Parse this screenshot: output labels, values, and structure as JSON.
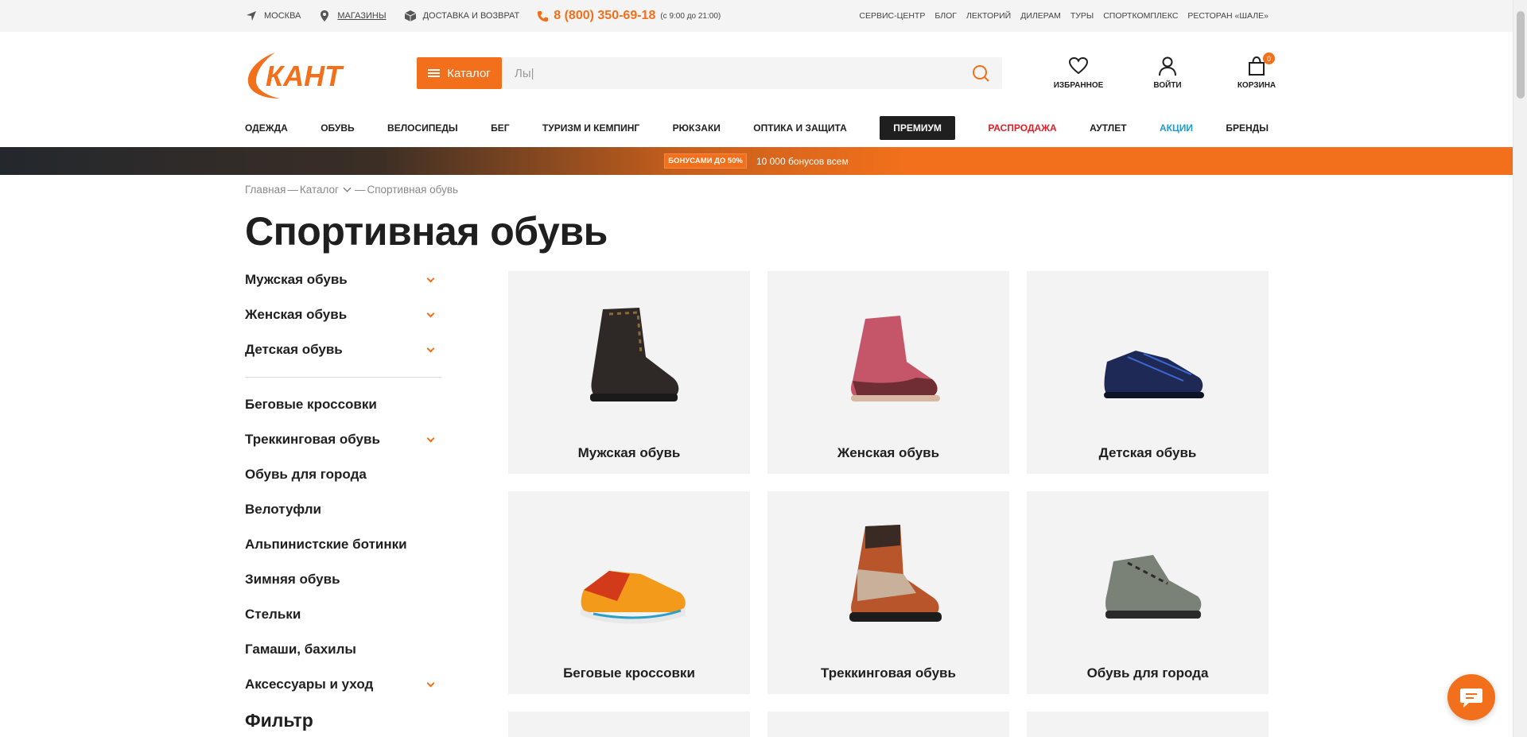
{
  "topbar": {
    "city": "Москва",
    "stores": "Магазины",
    "delivery": "Доставка и возврат",
    "phone": "8 (800) 350-69-18",
    "phone_hours": "(с 9:00 до 21:00)",
    "links": [
      "Сервис-центр",
      "Блог",
      "Лекторий",
      "Дилерам",
      "Туры",
      "Спорткомплекс",
      "Ресторан «Шале»"
    ]
  },
  "header": {
    "logo_text": "КАНТ",
    "catalog_label": "Каталог",
    "search_value": "Лы|",
    "favorites_label": "Избранное",
    "login_label": "Войти",
    "cart_label": "Корзина",
    "cart_count": "0"
  },
  "nav": {
    "items": [
      "Одежда",
      "Обувь",
      "Велосипеды",
      "Бег",
      "Туризм и кемпинг",
      "Рюкзаки",
      "Оптика и защита"
    ],
    "premium": "Премиум",
    "sale": "Распродажа",
    "outlet": "Аутлет",
    "promo": "Акции",
    "brands": "Бренды"
  },
  "banner": {
    "tag": "Бонусами до 50%",
    "text": "10 000 бонусов всем"
  },
  "breadcrumb": {
    "home": "Главная",
    "sep1": "—",
    "catalog": "Каталог",
    "sep2": "—",
    "current": "Спортивная обувь"
  },
  "page_title": "Спортивная обувь",
  "sidebar": {
    "group1": [
      {
        "label": "Мужская обувь",
        "expandable": true
      },
      {
        "label": "Женская обувь",
        "expandable": true
      },
      {
        "label": "Детская обувь",
        "expandable": true
      }
    ],
    "group2": [
      {
        "label": "Беговые кроссовки",
        "expandable": false
      },
      {
        "label": "Треккинговая обувь",
        "expandable": true
      },
      {
        "label": "Обувь для города",
        "expandable": false
      },
      {
        "label": "Велотуфли",
        "expandable": false
      },
      {
        "label": "Альпинистские ботинки",
        "expandable": false
      },
      {
        "label": "Зимняя обувь",
        "expandable": false
      },
      {
        "label": "Стельки",
        "expandable": false
      },
      {
        "label": "Гамаши, бахилы",
        "expandable": false
      },
      {
        "label": "Аксессуары и уход",
        "expandable": true
      }
    ],
    "filter_title": "Фильтр"
  },
  "categories": [
    {
      "label": "Мужская обувь",
      "icon": "dark-hiking-boot-image"
    },
    {
      "label": "Женская обувь",
      "icon": "pink-hiking-boot-image"
    },
    {
      "label": "Детская обувь",
      "icon": "navy-kids-shoe-image"
    },
    {
      "label": "Беговые кроссовки",
      "icon": "orange-running-shoe-image"
    },
    {
      "label": "Треккинговая обувь",
      "icon": "brown-trekking-boot-image"
    },
    {
      "label": "Обувь для города",
      "icon": "grey-city-shoe-image"
    }
  ],
  "colors": {
    "accent": "#f2701b",
    "sale": "#e21e26",
    "promo": "#1d9bd7",
    "dark": "#1f1f1f"
  }
}
